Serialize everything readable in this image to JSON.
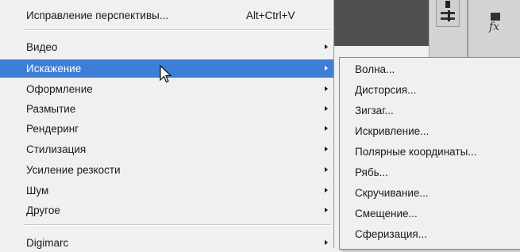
{
  "main_menu": {
    "items": [
      {
        "label": "Исправление перспективы...",
        "shortcut": "Alt+Ctrl+V"
      },
      {
        "label": "Видео"
      },
      {
        "label": "Искажение"
      },
      {
        "label": "Оформление"
      },
      {
        "label": "Размытие"
      },
      {
        "label": "Рендеринг"
      },
      {
        "label": "Стилизация"
      },
      {
        "label": "Усиление резкости"
      },
      {
        "label": "Шум"
      },
      {
        "label": "Другое"
      },
      {
        "label": "Digimarc"
      }
    ]
  },
  "submenu": {
    "items": [
      {
        "label": "Волна..."
      },
      {
        "label": "Дисторсия..."
      },
      {
        "label": "Зигзаг..."
      },
      {
        "label": "Искривление..."
      },
      {
        "label": "Полярные координаты..."
      },
      {
        "label": "Рябь..."
      },
      {
        "label": "Скручивание..."
      },
      {
        "label": "Смещение..."
      },
      {
        "label": "Сферизация..."
      }
    ]
  },
  "panel": {
    "fx_glyph": "fx"
  },
  "colors": {
    "selection": "#3d7fd4",
    "menu_bg": "#f0f0f0"
  }
}
